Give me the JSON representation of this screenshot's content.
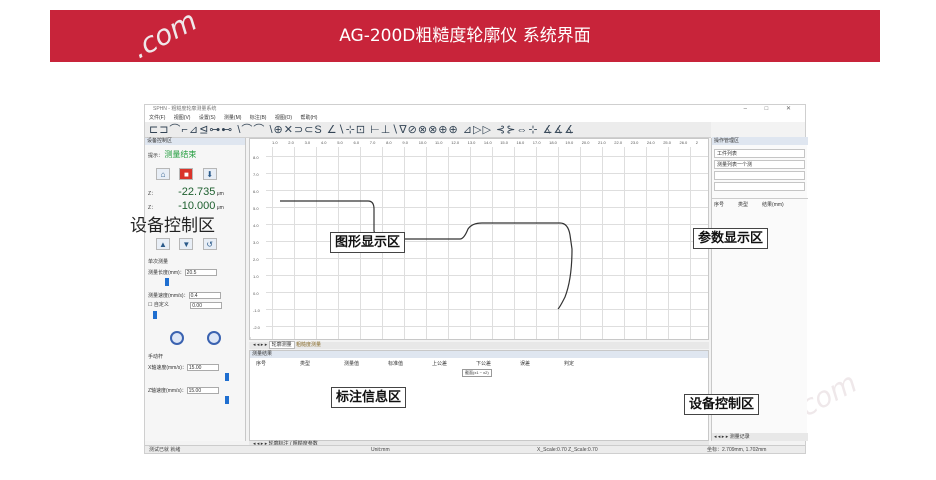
{
  "banner": {
    "title": "AG-200D粗糙度轮廓仪  系统界面"
  },
  "watermark": ".com",
  "app": {
    "title": "SPHN - 粗糙度轮廓测量系统",
    "menus": [
      "文件(F)",
      "视图(V)",
      "设置(S)",
      "测量(M)",
      "标注(B)",
      "视图(O)",
      "帮助(H)"
    ],
    "toolbar_glyphs": "⊏⊐⌒⌐⊿⊴⊶⊷ \\⌒⌒ \\⊕✕⊃⊂S ∠∖⊹⊡ ⊢⊥∖∇⊘⊗⊗⊕⊕ ⊿▷▷ ⊰⊱⇔⊹ ∡∡∡"
  },
  "left_panel": {
    "header": "设备控制区",
    "prompt_label": "提示：",
    "prompt_value": "测量结束",
    "z1_label": "Z：",
    "z1_value": "-22.735",
    "z2_label": "Z：",
    "z2_value": "-10.000",
    "unit": "μm",
    "section_single": "单次测量",
    "length_label": "测量长度(mm)：",
    "length_value": "20.5",
    "speed_label": "测量速度(mm/s)：",
    "speed_value": "0.4",
    "custom_label": "☐ 自定义",
    "custom_value": "0.00",
    "manual_label": "手动杆",
    "x_speed_label": "X轴速度(mm/s)：",
    "x_speed_value": "15.00",
    "z_speed_label": "Z轴速度(mm/s)：",
    "z_speed_value": "15.00"
  },
  "graph": {
    "x_ticks": [
      "1.0",
      "2.0",
      "3.0",
      "4.0",
      "5.0",
      "6.0",
      "7.0",
      "8.0",
      "9.0",
      "10.0",
      "11.0",
      "12.0",
      "13.0",
      "14.0",
      "15.0",
      "16.0",
      "17.0",
      "18.0",
      "19.0",
      "20.0",
      "21.0",
      "22.0",
      "23.0",
      "24.0",
      "25.0",
      "26.0",
      "2"
    ],
    "y_ticks": [
      "8.0",
      "7.0",
      "6.0",
      "5.0",
      "4.0",
      "3.0",
      "2.0",
      "1.0",
      "0.0",
      "-1.0",
      "-2.0"
    ],
    "tabs": [
      "轮廓测量",
      "粗糙度测量"
    ]
  },
  "marks": {
    "title": "测量结果",
    "columns": [
      "序号",
      "类型",
      "测量值",
      "标准值",
      "上公差",
      "下公差",
      "误差",
      "判定"
    ],
    "tooltip": "截面(x1 ~ x2)",
    "tabs": [
      "轮廓标注",
      "粗糙度参数"
    ]
  },
  "right_panel": {
    "header": "操作管理区",
    "box1": "工件列表",
    "box2": "测量列表一个测",
    "columns": [
      "序号",
      "类型",
      "结果(mm)"
    ],
    "bottom_tab": "测量记录"
  },
  "status": {
    "left": "测试已就 就绪",
    "mid": "Unit:mm",
    "scale": "X_Scale:0.70  Z_Scale:0.70",
    "right": "坐标：2.709mm, 1.702mm"
  },
  "labels": {
    "graph": "图形显示区",
    "params": "参数显示区",
    "marks": "标注信息区",
    "control": "设备控制区",
    "control_big": "设备控制区"
  }
}
